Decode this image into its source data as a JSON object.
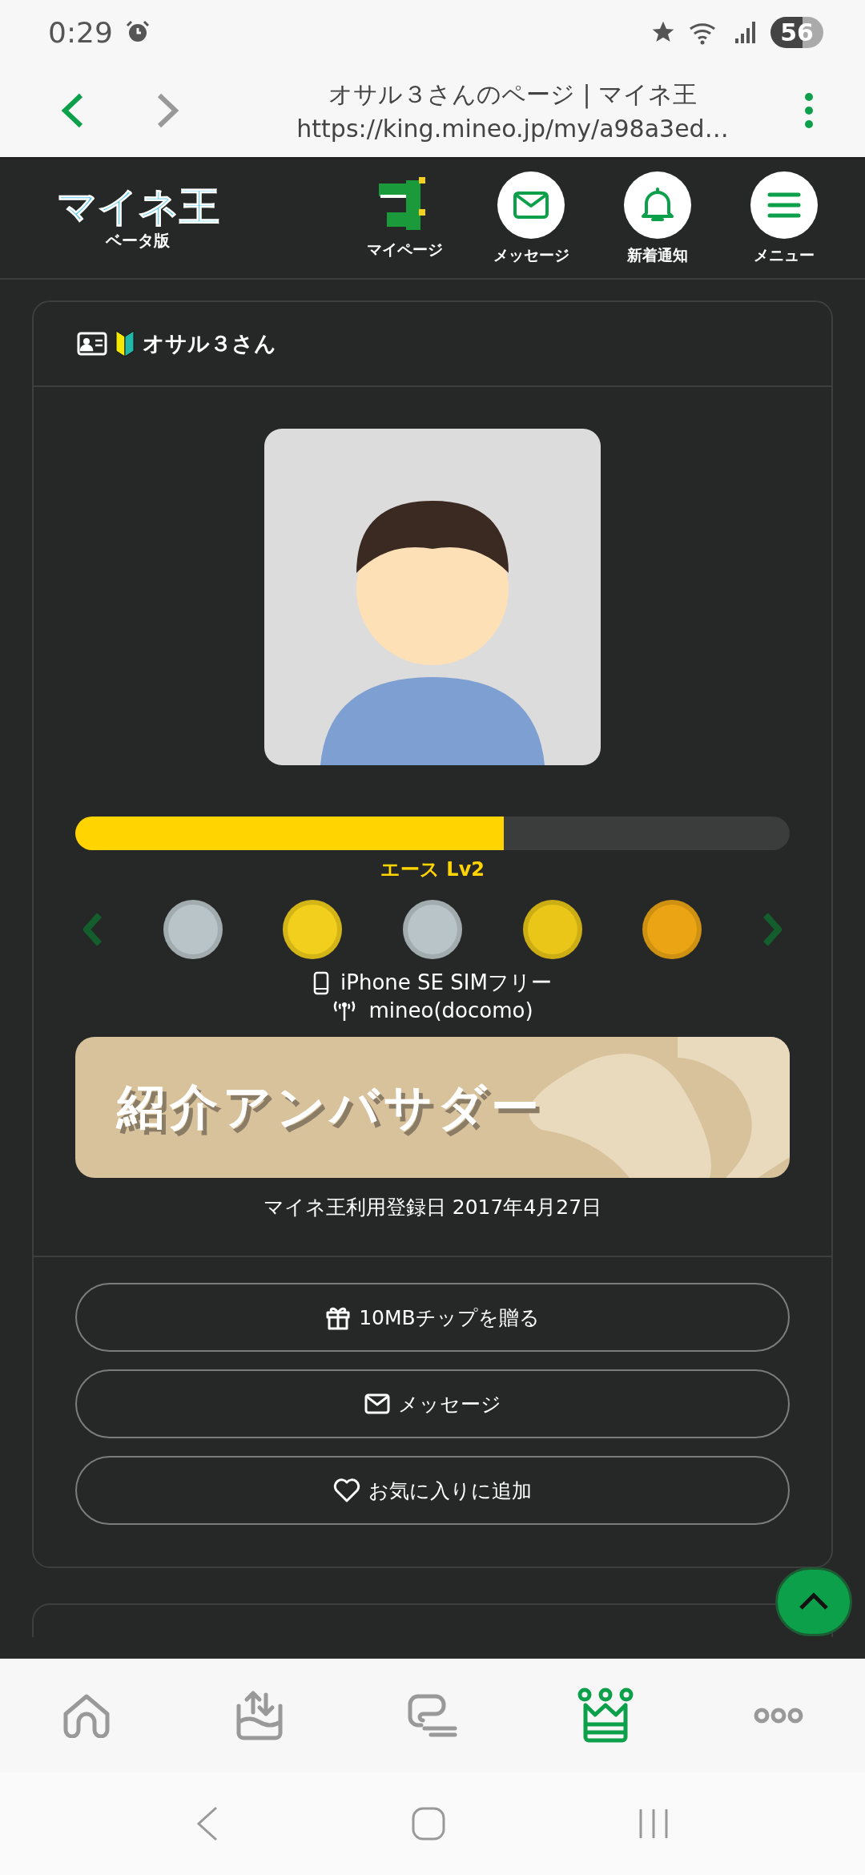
{
  "status_bar": {
    "time": "0:29",
    "battery": "56"
  },
  "browser": {
    "title": "オサル３さんのページ | マイネ王",
    "url": "https://king.mineo.jp/my/a98a3ed…"
  },
  "header": {
    "logo": "マイネ王",
    "logo_sub": "ベータ版",
    "nav": [
      {
        "kind": "mypage",
        "label": "マイページ"
      },
      {
        "kind": "message",
        "label": "メッセージ"
      },
      {
        "kind": "bell",
        "label": "新着通知"
      },
      {
        "kind": "menu",
        "label": "メニュー"
      }
    ]
  },
  "profile": {
    "name": "オサル３さん",
    "level": 0.6,
    "rank": "エース Lv2",
    "badges": [
      {
        "color": "#b9c4c8"
      },
      {
        "color": "#f2cf1c"
      },
      {
        "color": "#b9c4c8"
      },
      {
        "color": "#e9c617"
      },
      {
        "color": "#eba514"
      }
    ],
    "device": "iPhone SE SIMフリー",
    "carrier": "mineo(docomo)",
    "banner": "紹介アンバサダー",
    "registered": "マイネ王利用登録日 2017年4月27日",
    "actions": [
      {
        "kind": "gift",
        "label": "10MBチップを贈る"
      },
      {
        "kind": "mail",
        "label": "メッセージ"
      },
      {
        "kind": "heart",
        "label": "お気に入りに追加"
      }
    ]
  },
  "bottom_nav": [
    {
      "kind": "home",
      "selected": false
    },
    {
      "kind": "transfer",
      "selected": false
    },
    {
      "kind": "chat",
      "selected": false
    },
    {
      "kind": "king",
      "selected": true
    },
    {
      "kind": "more",
      "selected": false
    }
  ]
}
